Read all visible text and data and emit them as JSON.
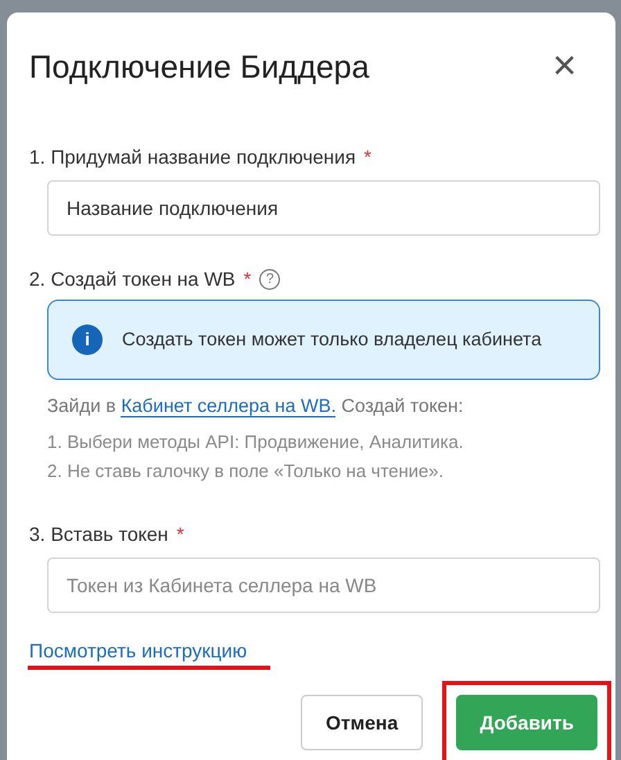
{
  "dialog": {
    "title": "Подключение Биддера",
    "close": "×"
  },
  "step_1": {
    "label": "1. Придумай название подключения",
    "required_mark": "*",
    "field": {
      "value": "Название подключения"
    }
  },
  "step_2": {
    "label": "2. Создай токен на WB",
    "required_mark": "*",
    "help": "?",
    "info": {
      "icon": "i",
      "text": "Создать токен может только владелец кабинета"
    },
    "intro_before": "Зайди в",
    "intro_link": "Кабинет селлера на WB.",
    "intro_after": "Создай токен:",
    "instructions": [
      "1. Выбери методы API: Продвижение, Аналитика.",
      "2. Не ставь галочку в поле «Только на чтение»."
    ]
  },
  "step_3": {
    "label": "3. Вставь токен",
    "required_mark": "*",
    "field": {
      "placeholder": "Токен из Кабинета селлера на WB"
    }
  },
  "instruction_link": {
    "label": "Посмотреть инструкцию",
    "highlighted": true
  },
  "buttons": [
    {
      "label": "Отмена",
      "kind": "secondary",
      "highlighted": false
    },
    {
      "label": "Добавить",
      "kind": "primary",
      "highlighted": true
    }
  ]
}
